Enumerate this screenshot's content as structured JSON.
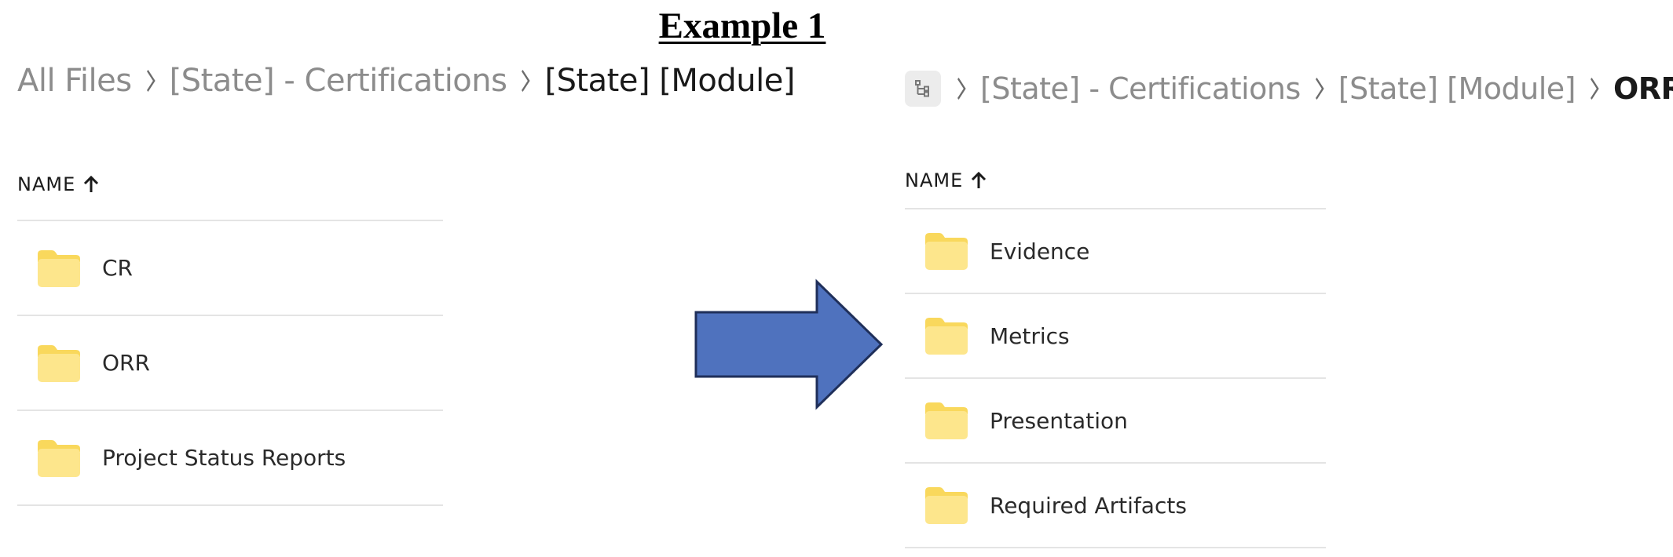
{
  "title": "Example 1",
  "colors": {
    "folder_fill": "#FDE68C",
    "folder_tab": "#F9D85C",
    "arrow_fill": "#4F72BE",
    "arrow_stroke": "#1F2F5A",
    "muted_text": "#8C8C8C",
    "divider": "#E4E4E4"
  },
  "left_panel": {
    "breadcrumb": {
      "items": [
        "All Files",
        "[State] - Certifications"
      ],
      "current": "[State] [Module]"
    },
    "column_header": "NAME",
    "sort_icon": "arrow-up-icon",
    "folders": [
      "CR",
      "ORR",
      "Project Status Reports"
    ]
  },
  "right_panel": {
    "breadcrumb": {
      "root_icon": "folder-tree-icon",
      "items": [
        "[State] - Certifications",
        "[State] [Module]"
      ],
      "current": "ORR"
    },
    "column_header": "NAME",
    "sort_icon": "arrow-up-icon",
    "folders": [
      "Evidence",
      "Metrics",
      "Presentation",
      "Required Artifacts"
    ]
  },
  "transition_icon": "right-arrow-icon"
}
